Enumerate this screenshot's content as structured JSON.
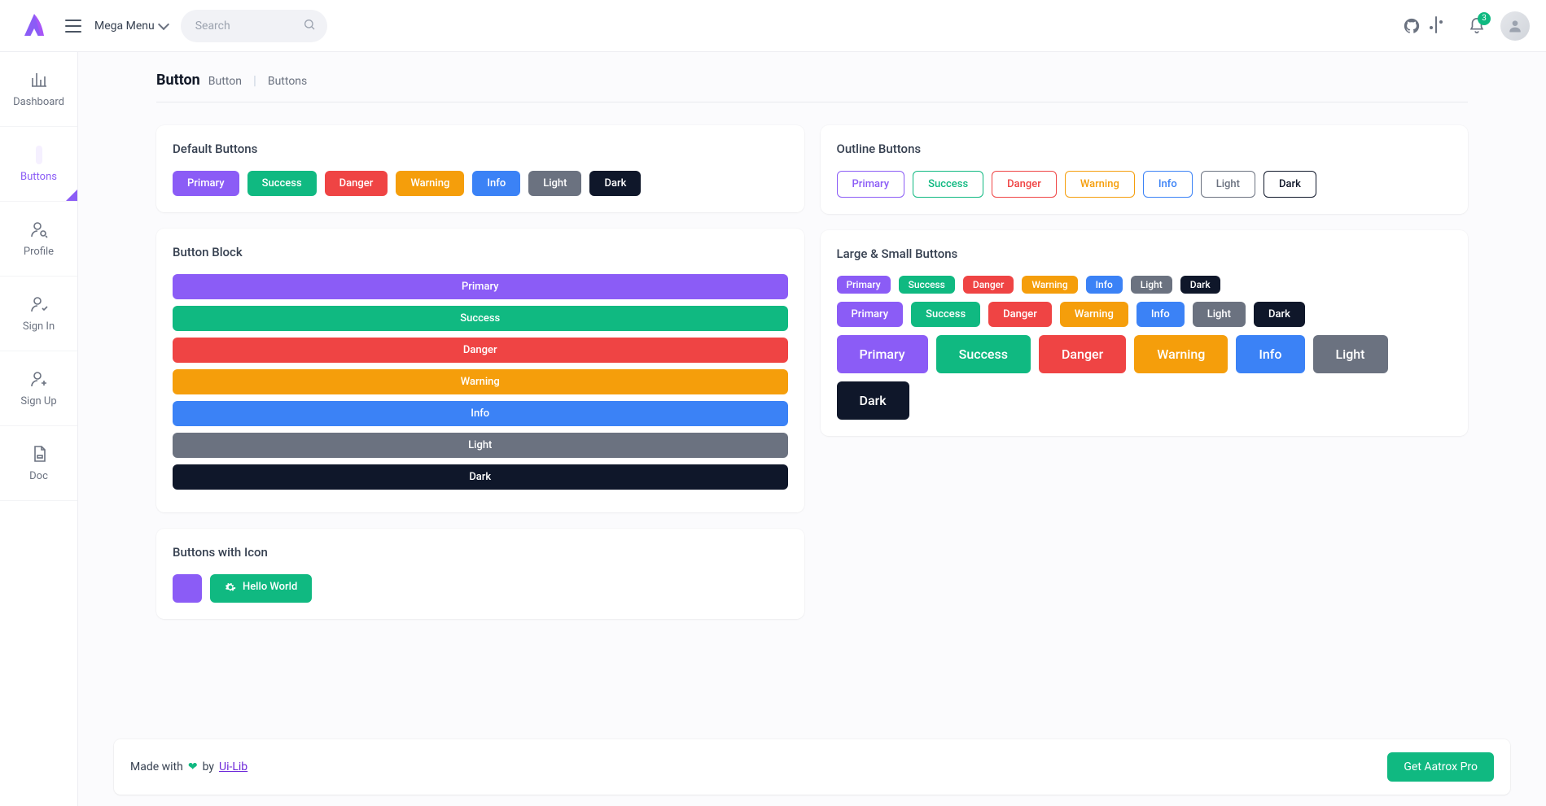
{
  "header": {
    "mega_menu": "Mega Menu",
    "search_placeholder": "Search",
    "notification_count": "3"
  },
  "sidebar": {
    "items": [
      {
        "label": "Dashboard"
      },
      {
        "label": "Buttons"
      },
      {
        "label": "Profile"
      },
      {
        "label": "Sign In"
      },
      {
        "label": "Sign Up"
      },
      {
        "label": "Doc"
      }
    ]
  },
  "page": {
    "title": "Button",
    "crumb1": "Button",
    "crumb2": "Buttons"
  },
  "cards": {
    "default_title": "Default Buttons",
    "outline_title": "Outline Buttons",
    "block_title": "Button Block",
    "sizes_title": "Large & Small Buttons",
    "icon_title": "Buttons with Icon"
  },
  "variants": {
    "primary": "Primary",
    "success": "Success",
    "danger": "Danger",
    "warning": "Warning",
    "info": "Info",
    "light": "Light",
    "dark": "Dark"
  },
  "icon_button_label": "Hello World",
  "footer": {
    "made_with": "Made with",
    "by": "by",
    "author": "Ui-Lib",
    "cta": "Get Aatrox Pro"
  }
}
